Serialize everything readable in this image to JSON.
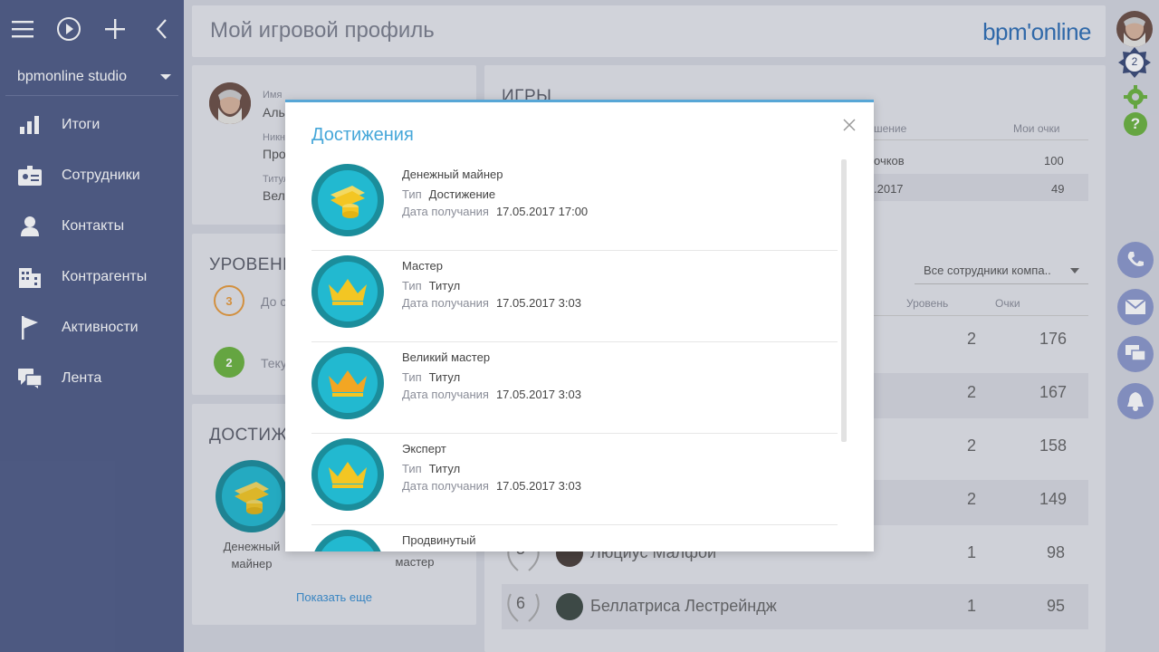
{
  "sidebar": {
    "studio": "bpmonline studio",
    "items": [
      {
        "label": "Итоги"
      },
      {
        "label": "Сотрудники"
      },
      {
        "label": "Контакты"
      },
      {
        "label": "Контрагенты"
      },
      {
        "label": "Активности"
      },
      {
        "label": "Лента"
      }
    ]
  },
  "header": {
    "title": "Мой игровой профиль",
    "brand": "bpm'online"
  },
  "profile": {
    "name_label": "Имя",
    "name_value": "Аль",
    "nick_label": "Никн",
    "nick_value": "Про",
    "title_label": "Титул",
    "title_value": "Вел"
  },
  "levels": {
    "title": "УРОВЕНЬ",
    "next_badge": "3",
    "next_text": "До с",
    "current_badge": "2",
    "current_text": "Теку"
  },
  "achievements_panel": {
    "title": "ДОСТИЖЕ",
    "item1": "Денежный майнер",
    "item2": "мастер",
    "show_more": "Показать еще"
  },
  "games": {
    "title": "ИГРЫ",
    "col_partial": "шение",
    "col_points": "Мои очки",
    "row1_text": "очков",
    "row1_points": "100",
    "row2_text": ".2017",
    "row2_points": "49"
  },
  "leaderboard": {
    "filter": "Все сотрудники компа..",
    "col_level": "Уровень",
    "col_points": "Очки",
    "rows": [
      {
        "level": "2",
        "points": "176"
      },
      {
        "level": "2",
        "points": "167"
      },
      {
        "level": "2",
        "points": "158"
      },
      {
        "level": "2",
        "points": "149"
      },
      {
        "rank": "5",
        "name": "Люциус Малфой",
        "level": "1",
        "points": "98"
      },
      {
        "rank": "6",
        "name": "Беллатриса Лестрейндж",
        "level": "1",
        "points": "95"
      }
    ]
  },
  "rail": {
    "notif_count": "2"
  },
  "modal": {
    "title": "Достижения",
    "type_label": "Тип",
    "date_label": "Дата получания",
    "items": [
      {
        "name": "Денежный майнер",
        "type": "Достижение",
        "date": "17.05.2017 17:00"
      },
      {
        "name": "Мастер",
        "type": "Титул",
        "date": "17.05.2017 3:03"
      },
      {
        "name": "Великий мастер",
        "type": "Титул",
        "date": "17.05.2017 3:03"
      },
      {
        "name": "Эксперт",
        "type": "Титул",
        "date": "17.05.2017 3:03"
      },
      {
        "name": "Продвинутый",
        "type": "",
        "date": ""
      }
    ]
  },
  "colors": {
    "sidebar": "#4f5c86",
    "accent": "#46a7d9",
    "medal_outer": "#1b8d9b",
    "medal_inner": "#22b9d0",
    "gold": "#f3c623"
  }
}
